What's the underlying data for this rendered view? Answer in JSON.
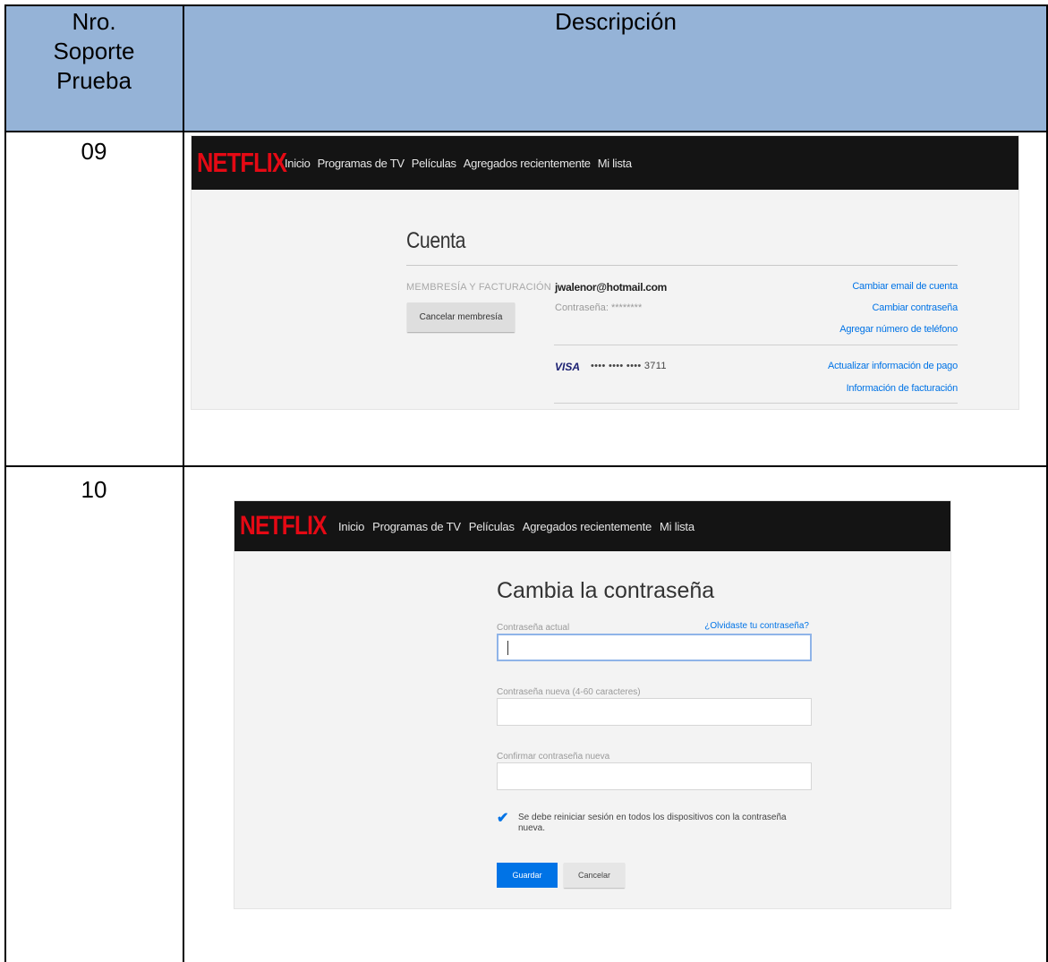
{
  "table": {
    "headers": {
      "col1": "Nro.\nSoporte\nPrueba",
      "col2": "Descripción"
    },
    "rows": [
      {
        "number": "09"
      },
      {
        "number": "10"
      }
    ]
  },
  "netflix": {
    "logo": "NETFLIX",
    "nav": [
      "Inicio",
      "Programas de TV",
      "Películas",
      "Agregados recientemente",
      "Mi lista"
    ]
  },
  "account": {
    "title": "Cuenta",
    "membership_label": "MEMBRESÍA Y FACTURACIÓN",
    "email": "jwalenor@hotmail.com",
    "password_label": "Contraseña: ********",
    "cancel_membership": "Cancelar membresía",
    "links": [
      "Cambiar email de cuenta",
      "Cambiar contraseña",
      "Agregar número de teléfono",
      "Actualizar información de pago",
      "Información de facturación"
    ],
    "card_brand": "VISA",
    "card_number": "•••• •••• •••• 3711"
  },
  "change_password": {
    "title": "Cambia la contraseña",
    "current_label": "Contraseña actual",
    "forgot_link": "¿Olvidaste tu contraseña?",
    "new_label": "Contraseña nueva (4-60 caracteres)",
    "confirm_label": "Confirmar contraseña nueva",
    "checkbox_text": "Se debe reiniciar sesión en todos los dispositivos con la contraseña nueva.",
    "save_button": "Guardar",
    "cancel_button": "Cancelar"
  },
  "colors": {
    "header_bg": "#95b3d7",
    "netflix_red": "#e50914",
    "link_blue": "#0073e6",
    "bar_black": "#141414"
  }
}
